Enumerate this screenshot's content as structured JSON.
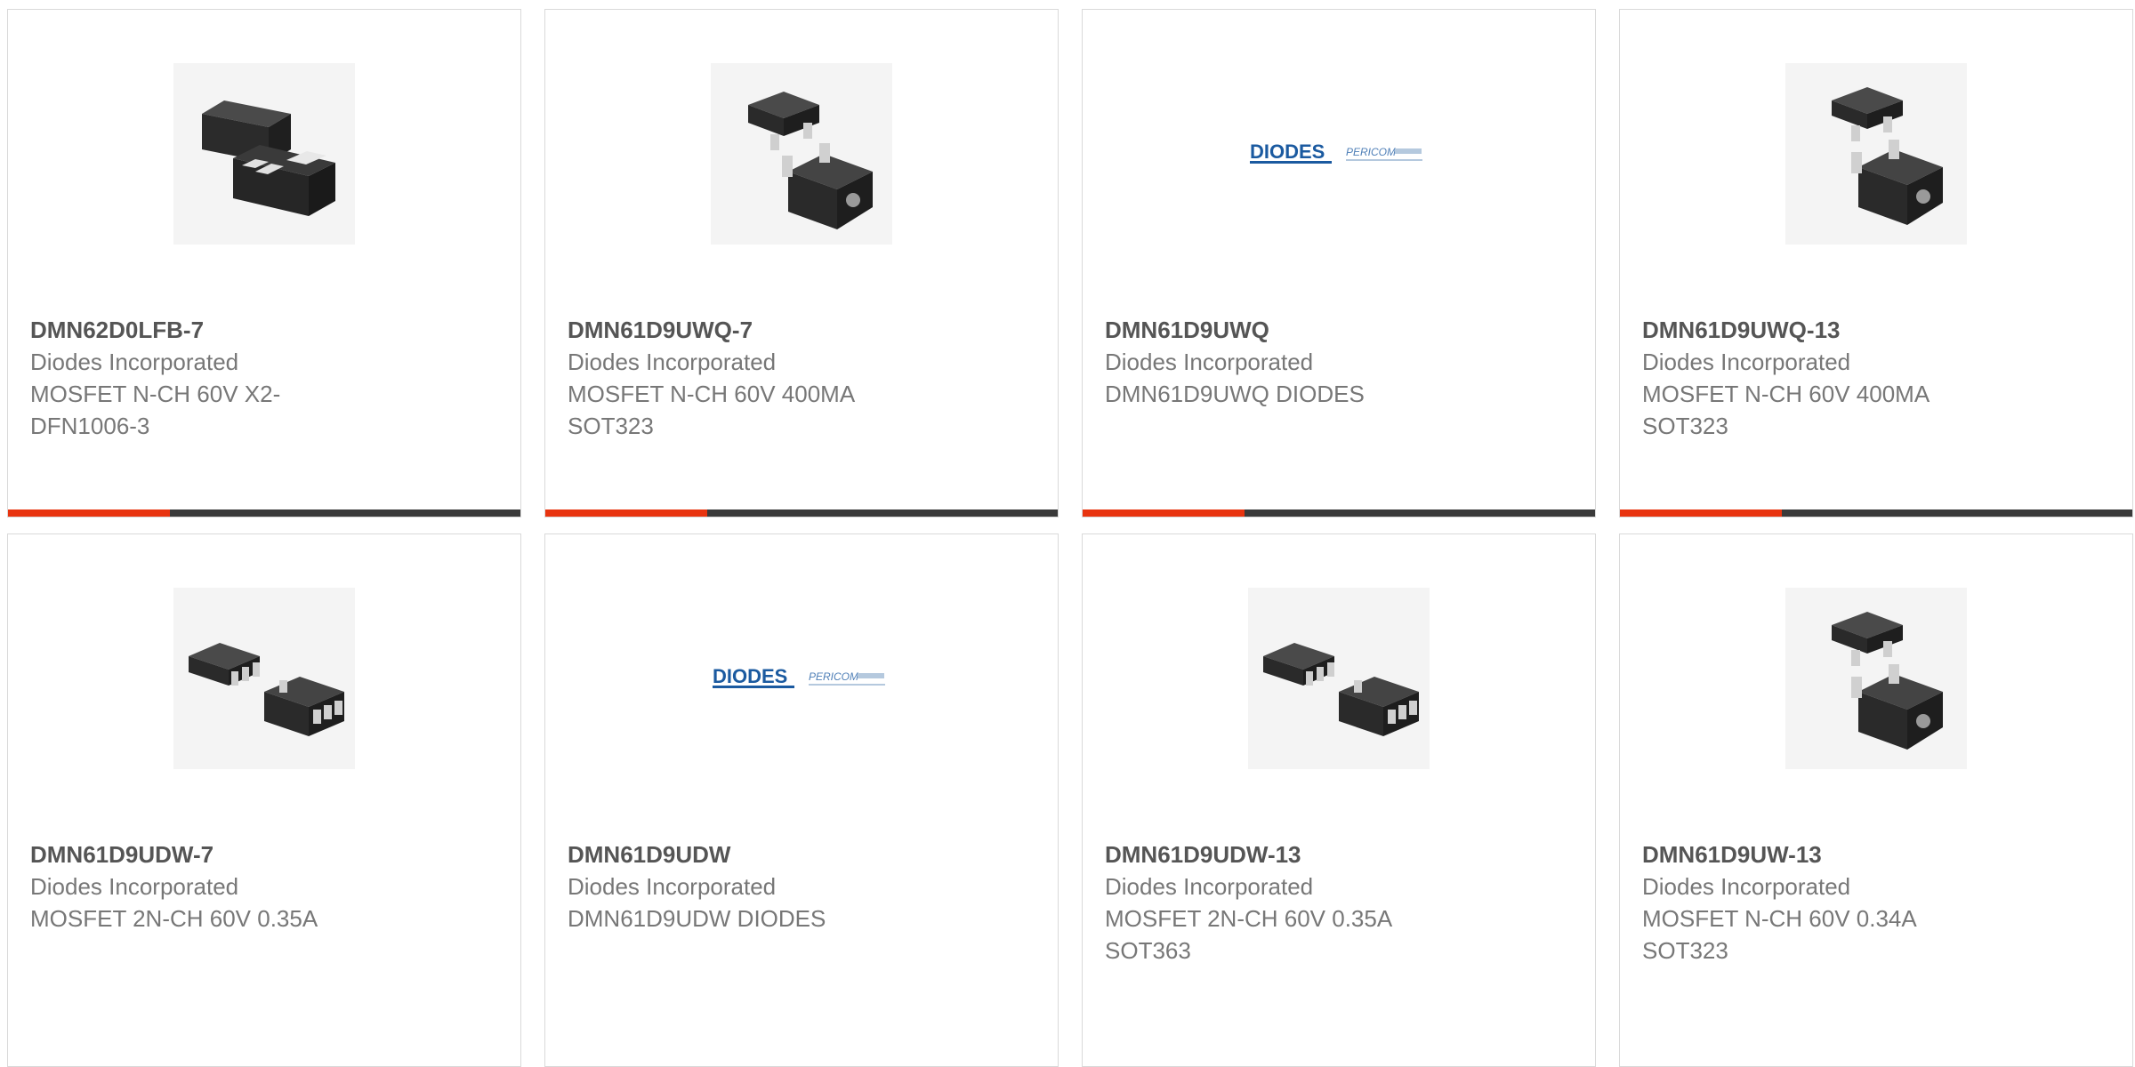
{
  "products": [
    {
      "part": "DMN62D0LFB-7",
      "manufacturer": "Diodes Incorporated",
      "description": "MOSFET N-CH 60V X2-DFN1006-3",
      "image": "x2-dfn-package-icon"
    },
    {
      "part": "DMN61D9UWQ-7",
      "manufacturer": "Diodes Incorporated",
      "description": "MOSFET N-CH 60V 400MA SOT323",
      "image": "sot323-package-icon"
    },
    {
      "part": "DMN61D9UWQ",
      "manufacturer": "Diodes Incorporated",
      "description": "DMN61D9UWQ DIODES",
      "image": "diodes-pericom-logo"
    },
    {
      "part": "DMN61D9UWQ-13",
      "manufacturer": "Diodes Incorporated",
      "description": "MOSFET N-CH 60V 400MA SOT323",
      "image": "sot323-package-icon"
    },
    {
      "part": "DMN61D9UDW-7",
      "manufacturer": "Diodes Incorporated",
      "description": "MOSFET 2N-CH 60V 0.35A",
      "image": "sot363-package-icon"
    },
    {
      "part": "DMN61D9UDW",
      "manufacturer": "Diodes Incorporated",
      "description": "DMN61D9UDW DIODES",
      "image": "diodes-pericom-logo"
    },
    {
      "part": "DMN61D9UDW-13",
      "manufacturer": "Diodes Incorporated",
      "description": "MOSFET 2N-CH 60V 0.35A SOT363",
      "image": "sot363-package-icon"
    },
    {
      "part": "DMN61D9UW-13",
      "manufacturer": "Diodes Incorporated",
      "description": "MOSFET N-CH 60V 0.34A SOT323",
      "image": "sot323-package-icon"
    }
  ],
  "logo": {
    "brand": "DIODES",
    "sub_brand": "PERICOM"
  },
  "colors": {
    "accent": "#e8340f",
    "bar": "#3a3a3a",
    "title": "#555555",
    "text": "#777777",
    "border": "#d9d9d9"
  }
}
